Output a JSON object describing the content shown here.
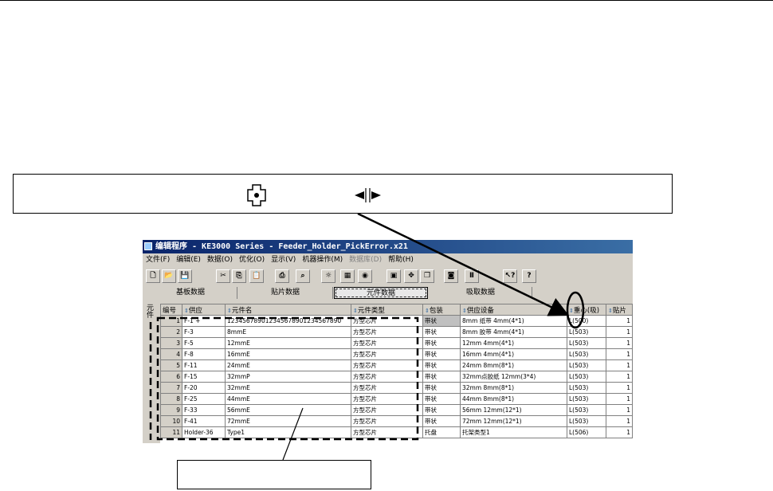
{
  "window": {
    "title": "编辑程序 - KE3000 Series - Feeder_Holder_PickError.x21",
    "menu": [
      {
        "label": "文件(F)",
        "dim": false
      },
      {
        "label": "编辑(E)",
        "dim": false
      },
      {
        "label": "数据(O)",
        "dim": false
      },
      {
        "label": "优化(O)",
        "dim": false
      },
      {
        "label": "显示(V)",
        "dim": false
      },
      {
        "label": "机器操作(M)",
        "dim": false
      },
      {
        "label": "数据库(D)",
        "dim": true
      },
      {
        "label": "帮助(H)",
        "dim": false
      }
    ],
    "toolbar": [
      "new-icon",
      "open-icon",
      "save-icon",
      "cut-icon",
      "copy-icon",
      "paste-icon",
      "print-icon",
      "find-icon",
      "bulb-icon",
      "component-icon",
      "color-icon",
      "teach-icon",
      "move-icon",
      "part-icon",
      "camera-icon",
      "pause-icon",
      "help-arrow-icon",
      "help-icon"
    ],
    "tabs": [
      "基板数据",
      "贴片数据",
      "元件数据",
      "吸取数据"
    ],
    "side_label": "元件",
    "columns": [
      "编号",
      "供应",
      "元件名",
      "元件类型",
      "包装",
      "供应设备",
      "重心(吸)",
      "贴片"
    ],
    "rows": [
      [
        "1",
        "F-1 +",
        "123456789012345678901234567890",
        "方型芯片",
        "带状",
        "8mm 纸带 4mm(4*1)",
        "L(500)",
        "1"
      ],
      [
        "2",
        "F-3",
        "8mmE",
        "方型芯片",
        "带状",
        "8mm 胶带 4mm(4*1)",
        "L(503)",
        "1"
      ],
      [
        "3",
        "F-5",
        "12mmE",
        "方型芯片",
        "带状",
        "12mm 4mm(4*1)",
        "L(503)",
        "1"
      ],
      [
        "4",
        "F-8",
        "16mmE",
        "方型芯片",
        "带状",
        "16mm 4mm(4*1)",
        "L(503)",
        "1"
      ],
      [
        "5",
        "F-11",
        "24mmE",
        "方型芯片",
        "带状",
        "24mm 8mm(8*1)",
        "L(503)",
        "1"
      ],
      [
        "6",
        "F-15",
        "32mmP",
        "方型芯片",
        "带状",
        "32mm点胶纸 12mm(3*4)",
        "L(503)",
        "1"
      ],
      [
        "7",
        "F-20",
        "32mmE",
        "方型芯片",
        "带状",
        "32mm 8mm(8*1)",
        "L(503)",
        "1"
      ],
      [
        "8",
        "F-25",
        "44mmE",
        "方型芯片",
        "带状",
        "44mm 8mm(8*1)",
        "L(503)",
        "1"
      ],
      [
        "9",
        "F-33",
        "56mmE",
        "方型芯片",
        "带状",
        "56mm 12mm(12*1)",
        "L(503)",
        "1"
      ],
      [
        "10",
        "F-41",
        "72mmE",
        "方型芯片",
        "带状",
        "72mm 12mm(12*1)",
        "L(503)",
        "1"
      ],
      [
        "11",
        "Holder-36",
        "Type1",
        "方型芯片",
        "托盘",
        "托架类型1",
        "L(506)",
        "1"
      ]
    ]
  },
  "colors": {
    "titlebar": "#0a246a",
    "face": "#d4d0c8"
  }
}
